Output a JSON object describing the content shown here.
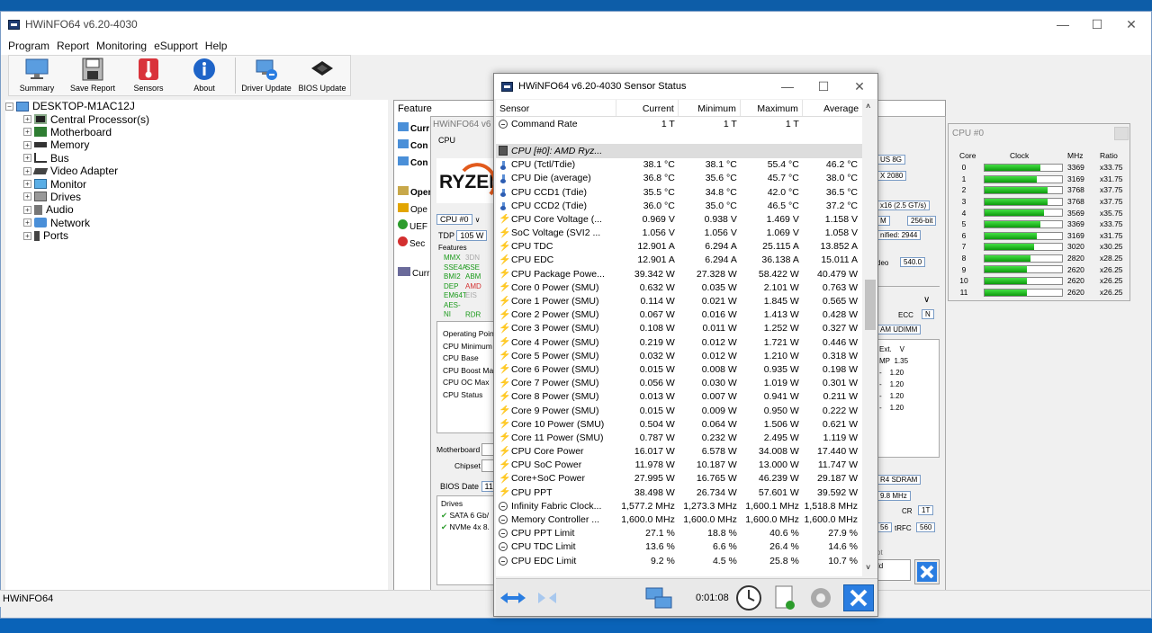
{
  "app": {
    "title": "HWiNFO64 v6.20-4030",
    "status": "HWiNFO64"
  },
  "menu": [
    "Program",
    "Report",
    "Monitoring",
    "eSupport",
    "Help"
  ],
  "toolbar": [
    {
      "label": "Summary",
      "icon": "monitor-icon"
    },
    {
      "label": "Save Report",
      "icon": "save-icon"
    },
    {
      "label": "Sensors",
      "icon": "thermometer-icon"
    },
    {
      "label": "About",
      "icon": "info-icon"
    },
    {
      "label": "Driver Update",
      "icon": "driver-update-icon"
    },
    {
      "label": "BIOS Update",
      "icon": "chip-icon"
    }
  ],
  "tree": {
    "root": "DESKTOP-M1AC12J",
    "items": [
      "Central Processor(s)",
      "Motherboard",
      "Memory",
      "Bus",
      "Video Adapter",
      "Monitor",
      "Drives",
      "Audio",
      "Network",
      "Ports"
    ]
  },
  "summary": {
    "feature_header": "Feature",
    "left_items": [
      "Curr",
      "Con",
      "Con",
      "Oper",
      "Ope",
      "UEF",
      "Sec",
      "Curr"
    ],
    "sub_title": "HWiNFO64 v6",
    "cpu_label": "CPU",
    "cpu_select": "CPU #0",
    "tdp_label": "TDP",
    "tdp_value": "105 W",
    "features_label": "Features",
    "features": [
      [
        "MMX",
        "3DN"
      ],
      [
        "SSE4A",
        "SSE"
      ],
      [
        "BMI2",
        "ABM"
      ],
      [
        "DEP",
        "AMD"
      ],
      [
        "EM64T",
        "EIS"
      ],
      [
        "AES-NI",
        "RDR"
      ]
    ],
    "op_point": "Operating Point",
    "op_rows": [
      "CPU Minimum",
      "CPU Base",
      "CPU Boost Max",
      "CPU OC Max",
      "CPU Status"
    ],
    "motherboard": "Motherboard",
    "chipset": "Chipset",
    "bios_date": "BIOS Date",
    "bios_val": "11",
    "drives": "Drives",
    "drive_items": [
      "SATA 6 Gb/",
      "NVMe 4x 8."
    ],
    "right_fields": [
      "US 8G",
      "X 2080",
      "x16 (2.5 GT/s)",
      "M",
      "256-bit",
      "nified: 2944",
      "deo",
      "540.0",
      "ECC",
      "N",
      "AM UDIMM",
      "Ext.",
      "V",
      "MP",
      "1.35",
      "-",
      "1.20",
      "-",
      "1.20",
      "-",
      "1.20",
      "-",
      "1.20",
      "R4 SDRAM",
      "9.8 MHz",
      "CR",
      "1T",
      "56",
      "tRFC",
      "560",
      "ot",
      "ld"
    ]
  },
  "core_window": {
    "title": "CPU #0",
    "headers": [
      "Core",
      "Clock",
      "MHz",
      "Ratio"
    ],
    "cores": [
      {
        "core": "0",
        "mhz": "3369",
        "ratio": "x33.75",
        "fill": 0.7
      },
      {
        "core": "1",
        "mhz": "3169",
        "ratio": "x31.75",
        "fill": 0.66
      },
      {
        "core": "2",
        "mhz": "3768",
        "ratio": "x37.75",
        "fill": 0.8
      },
      {
        "core": "3",
        "mhz": "3768",
        "ratio": "x37.75",
        "fill": 0.8
      },
      {
        "core": "4",
        "mhz": "3569",
        "ratio": "x35.75",
        "fill": 0.75
      },
      {
        "core": "5",
        "mhz": "3369",
        "ratio": "x33.75",
        "fill": 0.7
      },
      {
        "core": "6",
        "mhz": "3169",
        "ratio": "x31.75",
        "fill": 0.66
      },
      {
        "core": "7",
        "mhz": "3020",
        "ratio": "x30.25",
        "fill": 0.63
      },
      {
        "core": "8",
        "mhz": "2820",
        "ratio": "x28.25",
        "fill": 0.58
      },
      {
        "core": "9",
        "mhz": "2620",
        "ratio": "x26.25",
        "fill": 0.53
      },
      {
        "core": "10",
        "mhz": "2620",
        "ratio": "x26.25",
        "fill": 0.53
      },
      {
        "core": "11",
        "mhz": "2620",
        "ratio": "x26.25",
        "fill": 0.53
      }
    ]
  },
  "sensor": {
    "title": "HWiNFO64 v6.20-4030 Sensor Status",
    "columns": [
      "Sensor",
      "Current",
      "Minimum",
      "Maximum",
      "Average"
    ],
    "timer": "0:01:08",
    "rows": [
      {
        "icon": "clock-icon",
        "name": "Command Rate",
        "cur": "1 T",
        "min": "1 T",
        "max": "1 T",
        "avg": ""
      },
      {
        "icon": "",
        "name": "",
        "cur": "",
        "min": "",
        "max": "",
        "avg": ""
      },
      {
        "icon": "chip-icon",
        "name": "CPU [#0]: AMD Ryz...",
        "cur": "",
        "min": "",
        "max": "",
        "avg": "",
        "hdr": true
      },
      {
        "icon": "thermometer-icon",
        "name": "CPU (Tctl/Tdie)",
        "cur": "38.1 °C",
        "min": "38.1 °C",
        "max": "55.4 °C",
        "avg": "46.2 °C"
      },
      {
        "icon": "thermometer-icon",
        "name": "CPU Die (average)",
        "cur": "36.8 °C",
        "min": "35.6 °C",
        "max": "45.7 °C",
        "avg": "38.0 °C"
      },
      {
        "icon": "thermometer-icon",
        "name": "CPU CCD1 (Tdie)",
        "cur": "35.5 °C",
        "min": "34.8 °C",
        "max": "42.0 °C",
        "avg": "36.5 °C"
      },
      {
        "icon": "thermometer-icon",
        "name": "CPU CCD2 (Tdie)",
        "cur": "36.0 °C",
        "min": "35.0 °C",
        "max": "46.5 °C",
        "avg": "37.2 °C"
      },
      {
        "icon": "bolt-icon",
        "name": "CPU Core Voltage (...",
        "cur": "0.969 V",
        "min": "0.938 V",
        "max": "1.469 V",
        "avg": "1.158 V"
      },
      {
        "icon": "bolt-icon",
        "name": "SoC Voltage (SVI2 ...",
        "cur": "1.056 V",
        "min": "1.056 V",
        "max": "1.069 V",
        "avg": "1.058 V"
      },
      {
        "icon": "bolt-icon",
        "name": "CPU TDC",
        "cur": "12.901 A",
        "min": "6.294 A",
        "max": "25.115 A",
        "avg": "13.852 A"
      },
      {
        "icon": "bolt-icon",
        "name": "CPU EDC",
        "cur": "12.901 A",
        "min": "6.294 A",
        "max": "36.138 A",
        "avg": "15.011 A"
      },
      {
        "icon": "bolt-icon",
        "name": "CPU Package Powe...",
        "cur": "39.342 W",
        "min": "27.328 W",
        "max": "58.422 W",
        "avg": "40.479 W"
      },
      {
        "icon": "bolt-icon",
        "name": "Core 0 Power (SMU)",
        "cur": "0.632 W",
        "min": "0.035 W",
        "max": "2.101 W",
        "avg": "0.763 W"
      },
      {
        "icon": "bolt-icon",
        "name": "Core 1 Power (SMU)",
        "cur": "0.114 W",
        "min": "0.021 W",
        "max": "1.845 W",
        "avg": "0.565 W"
      },
      {
        "icon": "bolt-icon",
        "name": "Core 2 Power (SMU)",
        "cur": "0.067 W",
        "min": "0.016 W",
        "max": "1.413 W",
        "avg": "0.428 W"
      },
      {
        "icon": "bolt-icon",
        "name": "Core 3 Power (SMU)",
        "cur": "0.108 W",
        "min": "0.011 W",
        "max": "1.252 W",
        "avg": "0.327 W"
      },
      {
        "icon": "bolt-icon",
        "name": "Core 4 Power (SMU)",
        "cur": "0.219 W",
        "min": "0.012 W",
        "max": "1.721 W",
        "avg": "0.446 W"
      },
      {
        "icon": "bolt-icon",
        "name": "Core 5 Power (SMU)",
        "cur": "0.032 W",
        "min": "0.012 W",
        "max": "1.210 W",
        "avg": "0.318 W"
      },
      {
        "icon": "bolt-icon",
        "name": "Core 6 Power (SMU)",
        "cur": "0.015 W",
        "min": "0.008 W",
        "max": "0.935 W",
        "avg": "0.198 W"
      },
      {
        "icon": "bolt-icon",
        "name": "Core 7 Power (SMU)",
        "cur": "0.056 W",
        "min": "0.030 W",
        "max": "1.019 W",
        "avg": "0.301 W"
      },
      {
        "icon": "bolt-icon",
        "name": "Core 8 Power (SMU)",
        "cur": "0.013 W",
        "min": "0.007 W",
        "max": "0.941 W",
        "avg": "0.211 W"
      },
      {
        "icon": "bolt-icon",
        "name": "Core 9 Power (SMU)",
        "cur": "0.015 W",
        "min": "0.009 W",
        "max": "0.950 W",
        "avg": "0.222 W"
      },
      {
        "icon": "bolt-icon",
        "name": "Core 10 Power (SMU)",
        "cur": "0.504 W",
        "min": "0.064 W",
        "max": "1.506 W",
        "avg": "0.621 W"
      },
      {
        "icon": "bolt-icon",
        "name": "Core 11 Power (SMU)",
        "cur": "0.787 W",
        "min": "0.232 W",
        "max": "2.495 W",
        "avg": "1.119 W"
      },
      {
        "icon": "bolt-icon",
        "name": "CPU Core Power",
        "cur": "16.017 W",
        "min": "6.578 W",
        "max": "34.008 W",
        "avg": "17.440 W"
      },
      {
        "icon": "bolt-icon",
        "name": "CPU SoC Power",
        "cur": "11.978 W",
        "min": "10.187 W",
        "max": "13.000 W",
        "avg": "11.747 W"
      },
      {
        "icon": "bolt-icon",
        "name": "Core+SoC Power",
        "cur": "27.995 W",
        "min": "16.765 W",
        "max": "46.239 W",
        "avg": "29.187 W"
      },
      {
        "icon": "bolt-icon",
        "name": "CPU PPT",
        "cur": "38.498 W",
        "min": "26.734 W",
        "max": "57.601 W",
        "avg": "39.592 W"
      },
      {
        "icon": "clock-icon",
        "name": "Infinity Fabric Clock...",
        "cur": "1,577.2 MHz",
        "min": "1,273.3 MHz",
        "max": "1,600.1 MHz",
        "avg": "1,518.8 MHz"
      },
      {
        "icon": "clock-icon",
        "name": "Memory Controller ...",
        "cur": "1,600.0 MHz",
        "min": "1,600.0 MHz",
        "max": "1,600.0 MHz",
        "avg": "1,600.0 MHz"
      },
      {
        "icon": "clock-icon",
        "name": "CPU PPT Limit",
        "cur": "27.1 %",
        "min": "18.8 %",
        "max": "40.6 %",
        "avg": "27.9 %"
      },
      {
        "icon": "clock-icon",
        "name": "CPU TDC Limit",
        "cur": "13.6 %",
        "min": "6.6 %",
        "max": "26.4 %",
        "avg": "14.6 %"
      },
      {
        "icon": "clock-icon",
        "name": "CPU EDC Limit",
        "cur": "9.2 %",
        "min": "4.5 %",
        "max": "25.8 %",
        "avg": "10.7 %"
      }
    ]
  }
}
